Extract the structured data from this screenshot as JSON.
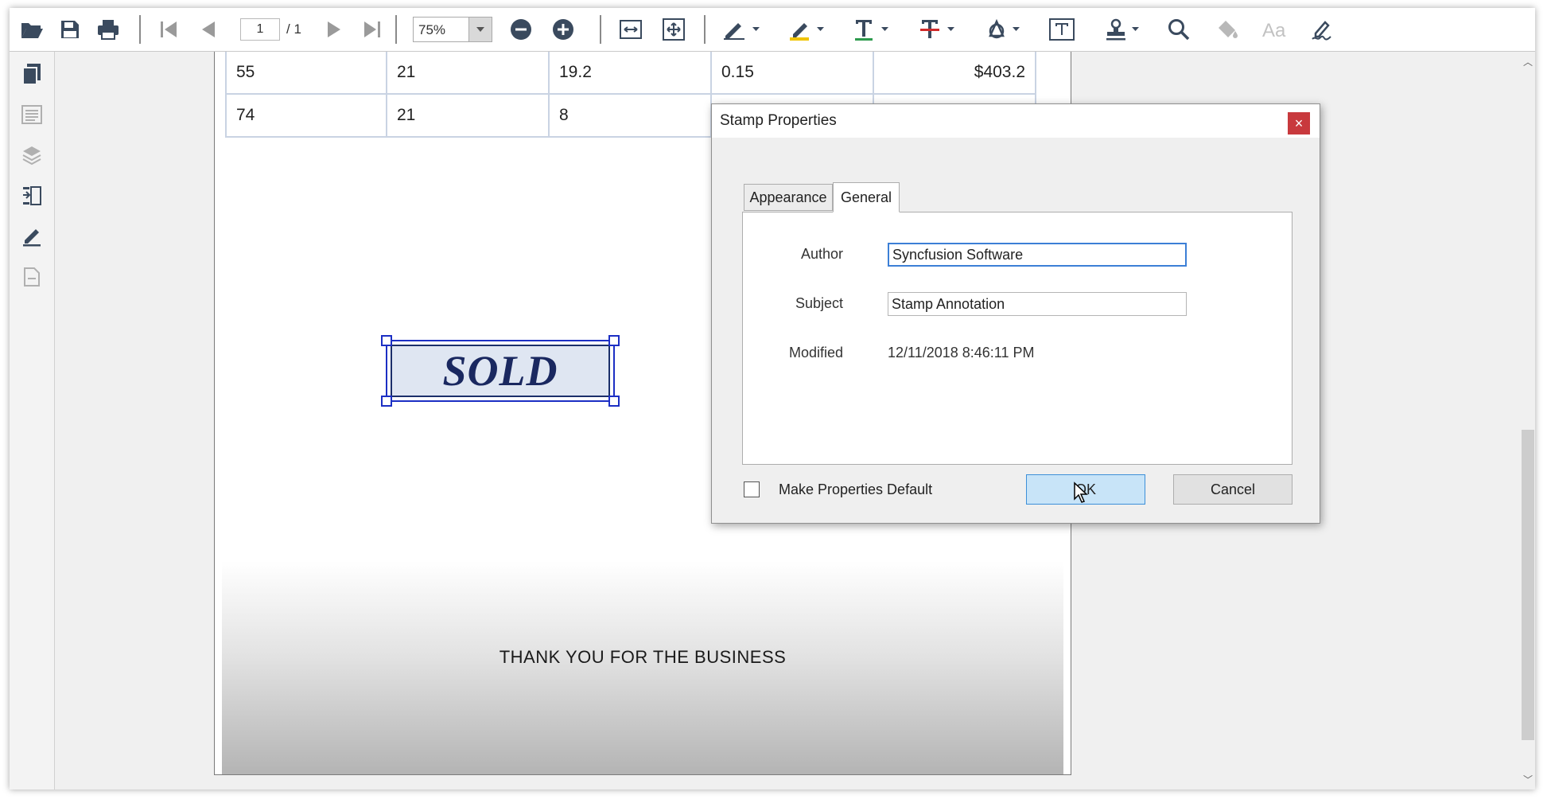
{
  "toolbar": {
    "icons": [
      "open-file-icon",
      "save-icon",
      "print-icon",
      "first-page-icon",
      "previous-page-icon",
      "next-page-icon",
      "last-page-icon",
      "zoom-out-icon",
      "zoom-in-icon",
      "fit-width-icon",
      "fit-page-icon",
      "ink-pen-icon",
      "highlight-icon",
      "text-markup-icon",
      "strikethrough-icon",
      "shape-icon",
      "free-text-icon",
      "stamp-icon",
      "search-icon",
      "fill-icon",
      "font-icon",
      "signature-icon"
    ],
    "page_number": "1",
    "page_total": "/ 1",
    "zoom_value": "75%"
  },
  "leftnav": {
    "icons": [
      "page-thumbnails-icon",
      "bookmarks-icon",
      "layers-icon",
      "organize-pages-icon",
      "signatures-icon",
      "attachments-icon"
    ]
  },
  "document": {
    "table_rows": [
      [
        "55",
        "21",
        "19.2",
        "0.15",
        "$403.2"
      ],
      [
        "74",
        "21",
        "8",
        "",
        ""
      ]
    ],
    "stamp_text": "SOLD",
    "footer_text": "THANK YOU FOR THE BUSINESS"
  },
  "dialog": {
    "title": "Stamp Properties",
    "close_label": "×",
    "tabs": [
      "Appearance",
      "General"
    ],
    "active_tab": "General",
    "author_label": "Author",
    "author_value": "Syncfusion Software",
    "subject_label": "Subject",
    "subject_value": "Stamp Annotation",
    "modified_label": "Modified",
    "modified_value": "12/11/2018 8:46:11 PM",
    "make_default_label": "Make Properties Default",
    "make_default_checked": false,
    "ok_label": "OK",
    "cancel_label": "Cancel"
  },
  "colors": {
    "accent": "#3c7fd6",
    "stamp_text": "#1a2860",
    "close_button": "#c8393d",
    "ok_button": "#c8e4f8"
  }
}
